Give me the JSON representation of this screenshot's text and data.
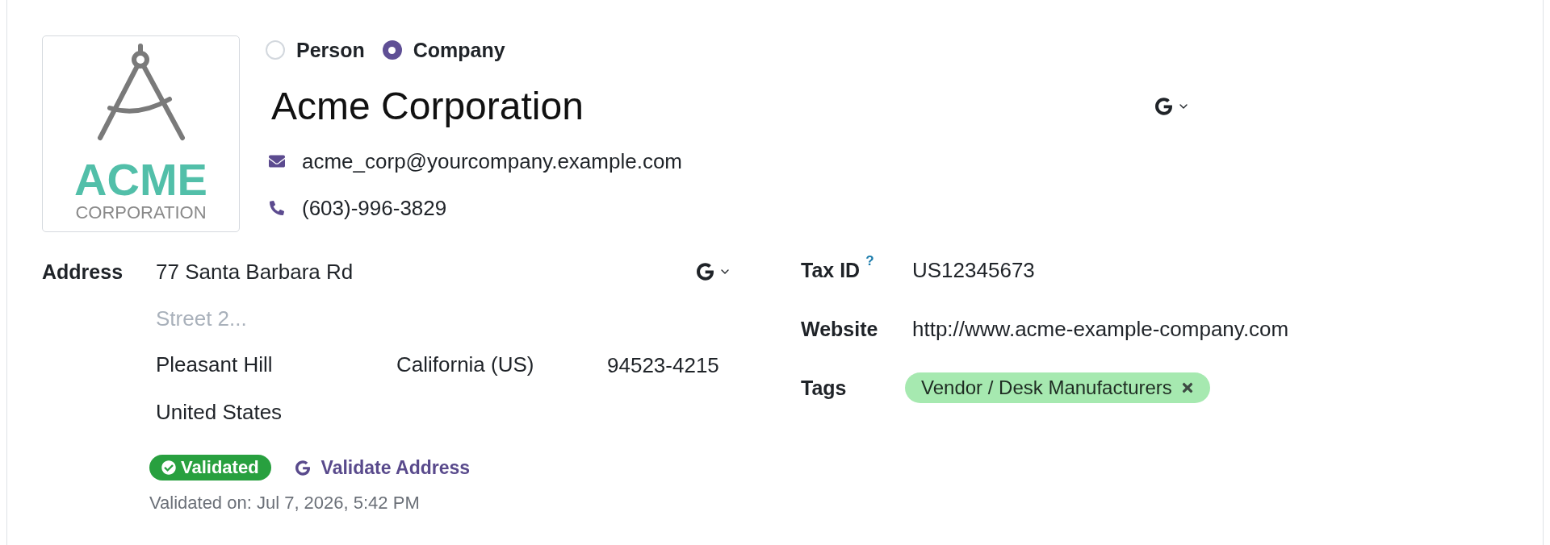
{
  "company_type": [
    {
      "label": "Person",
      "selected": false
    },
    {
      "label": "Company",
      "selected": true
    }
  ],
  "logo": {
    "wordmark": "ACME",
    "subtitle": "CORPORATION"
  },
  "name": "Acme Corporation",
  "contacts": [
    {
      "kind": "email",
      "value": "acme_corp@yourcompany.example.com"
    },
    {
      "kind": "phone",
      "value": "(603)-996-3829"
    }
  ],
  "address": {
    "label": "Address",
    "street": "77 Santa Barbara Rd",
    "street2": {
      "placeholder": "Street 2..."
    },
    "city": "Pleasant Hill",
    "state": "California (US)",
    "zip": "94523-4215",
    "country": "United States",
    "status": {
      "label": "Validated",
      "validated": true
    },
    "validate_link": "Validate Address",
    "validated_on": "Validated on: Jul 7, 2026, 5:42 PM"
  },
  "fields": [
    {
      "kind": "text",
      "label": "Tax ID",
      "help": "?",
      "value": "US12345673"
    },
    {
      "kind": "text",
      "label": "Website",
      "value": "http://www.acme-example-company.com"
    },
    {
      "kind": "tags",
      "label": "Tags",
      "tags": [
        {
          "label": "Vendor / Desk Manufacturers",
          "color": "#a6e9b0"
        }
      ]
    }
  ]
}
